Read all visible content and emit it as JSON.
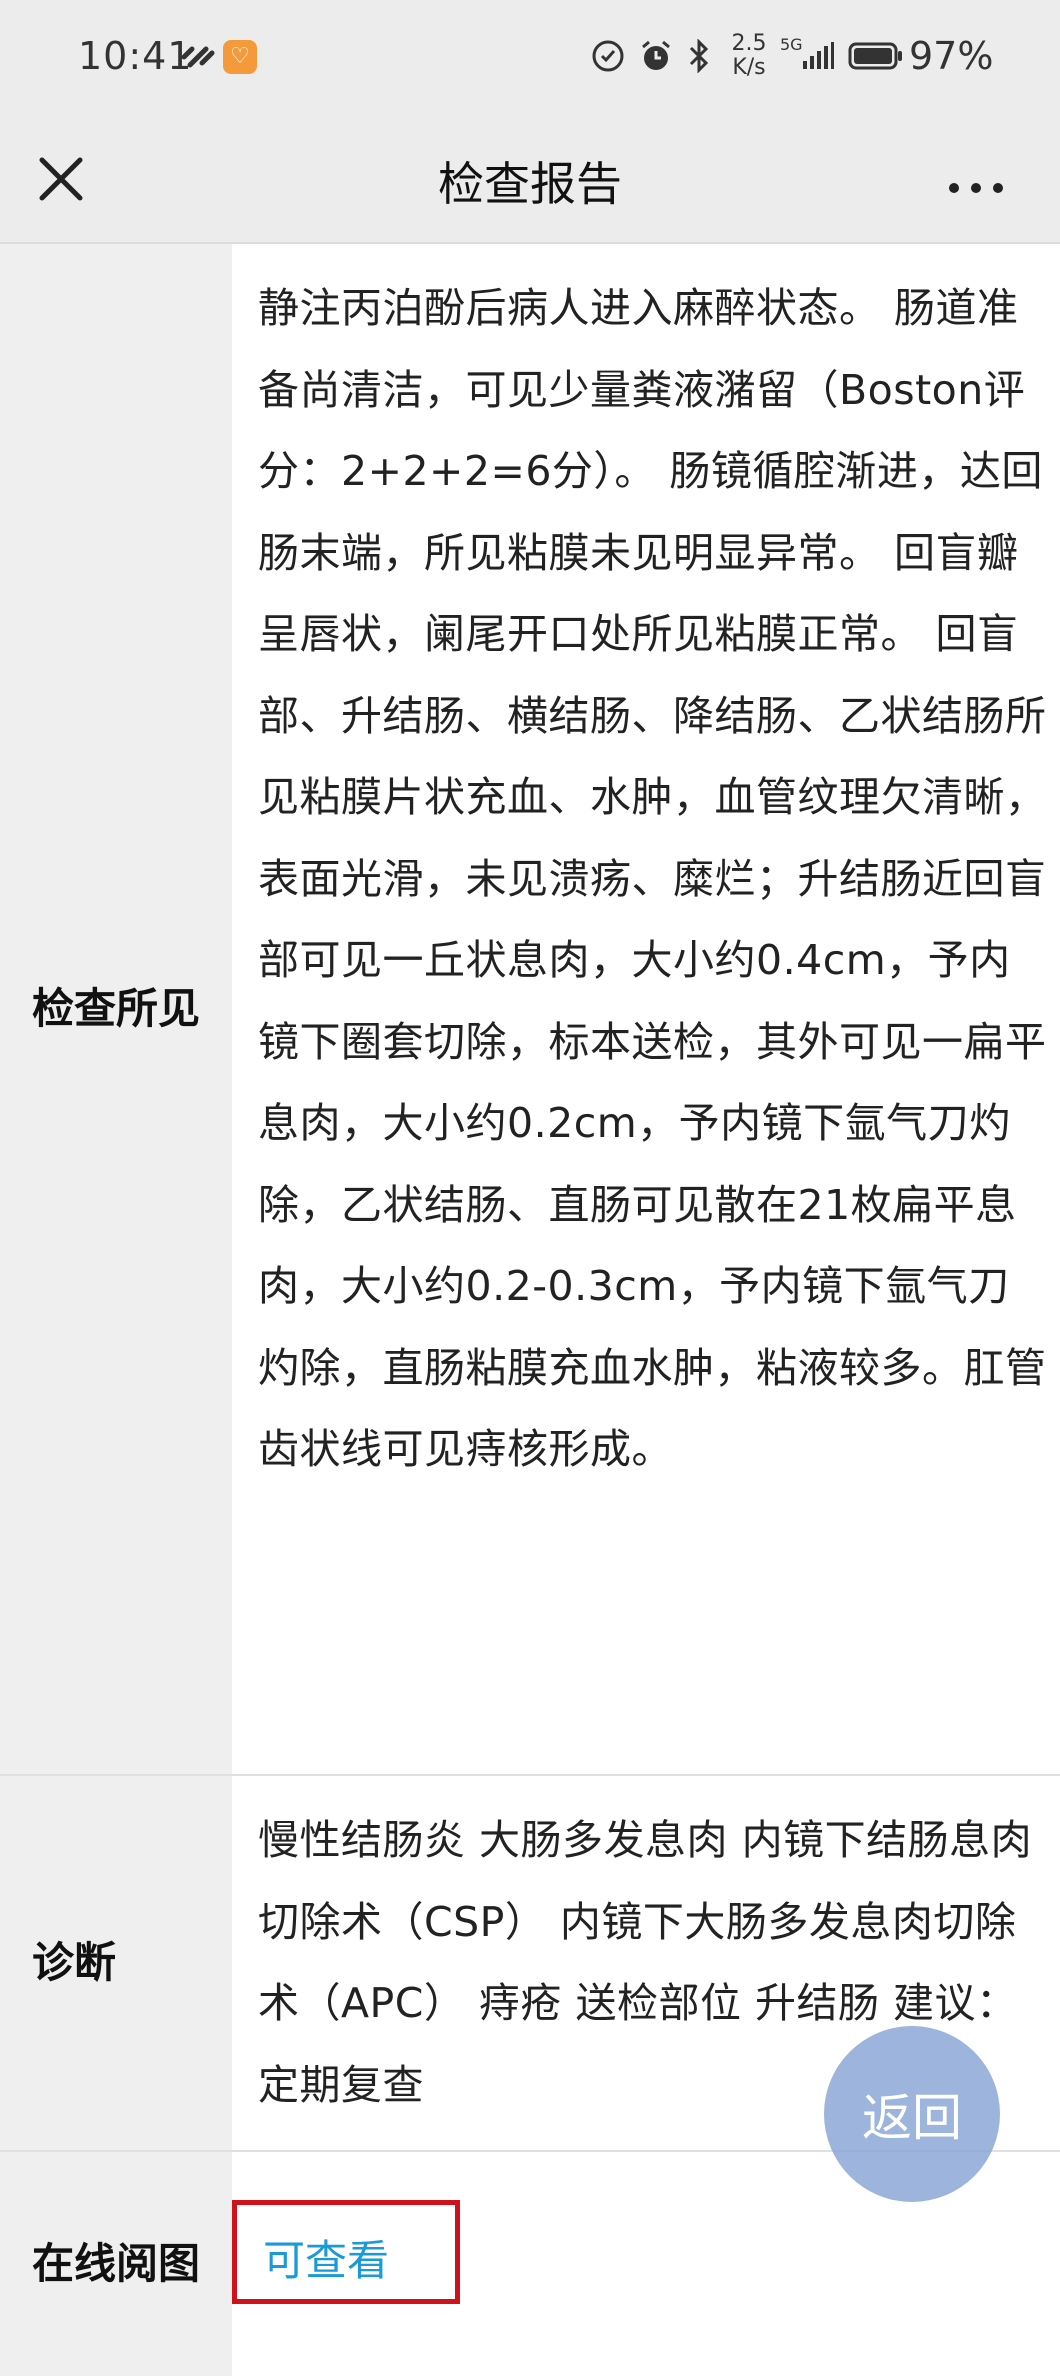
{
  "status_bar": {
    "time": "10:41",
    "net_speed_value": "2.5",
    "net_speed_unit": "K/s",
    "network_type": "5G",
    "battery_percent": "97%"
  },
  "header": {
    "title": "检查报告"
  },
  "report": {
    "findings": {
      "label": "检查所见",
      "text": "静注丙泊酚后病人进入麻醉状态。 肠道准备尚清洁，可见少量粪液潴留（Boston评分：2+2+2=6分）。 肠镜循腔渐进，达回肠末端，所见粘膜未见明显异常。 回盲瓣呈唇状，阑尾开口处所见粘膜正常。 回盲部、升结肠、横结肠、降结肠、乙状结肠所见粘膜片状充血、水肿，血管纹理欠清晰，表面光滑，未见溃疡、糜烂；升结肠近回盲部可见一丘状息肉，大小约0.4cm，予内镜下圈套切除，标本送检，其外可见一扁平息肉，大小约0.2cm，予内镜下氩气刀灼除，乙状结肠、直肠可见散在21枚扁平息肉，大小约0.2-0.3cm，予内镜下氩气刀灼除，直肠粘膜充血水肿，粘液较多。肛管齿状线可见痔核形成。"
    },
    "diagnosis": {
      "label": "诊断",
      "text": "慢性结肠炎 大肠多发息肉 内镜下结肠息肉切除术（CSP） 内镜下大肠多发息肉切除术（APC） 痔疮 送检部位 升结肠 建议：定期复查"
    },
    "online_image": {
      "label": "在线阅图",
      "link_text": "可查看"
    }
  },
  "floating": {
    "return_label": "返回"
  },
  "colors": {
    "link": "#1a9ad6",
    "highlight_border": "#d0101b",
    "return_button": "#88a4d6"
  }
}
